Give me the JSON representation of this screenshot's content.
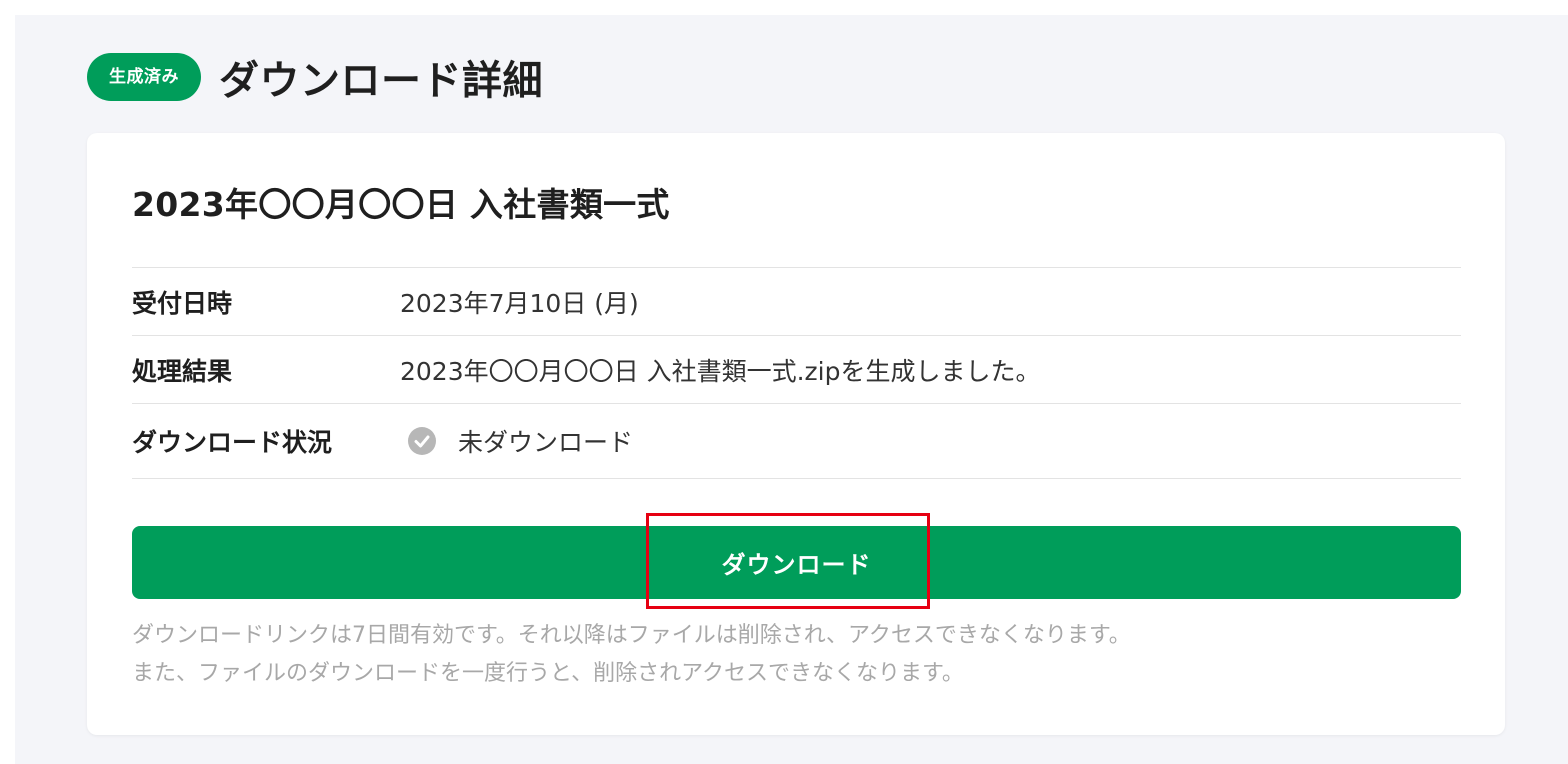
{
  "header": {
    "badge": "生成済み",
    "title": "ダウンロード詳細"
  },
  "card": {
    "title": "2023年〇〇月〇〇日 入社書類一式",
    "rows": [
      {
        "label": "受付日時",
        "value": "2023年7月10日 (月)"
      },
      {
        "label": "処理結果",
        "value": "2023年〇〇月〇〇日 入社書類一式.zipを生成しました。"
      },
      {
        "label": "ダウンロード状況",
        "value": "未ダウンロード",
        "icon": "check-circle-icon"
      }
    ],
    "download_button": "ダウンロード",
    "notes": [
      "ダウンロードリンクは7日間有効です。それ以降はファイルは削除され、アクセスできなくなります。",
      "また、ファイルのダウンロードを一度行うと、削除されアクセスできなくなります。"
    ]
  },
  "colors": {
    "accent": "#009d5a",
    "highlight": "#e60012",
    "background": "#f4f5f9"
  }
}
